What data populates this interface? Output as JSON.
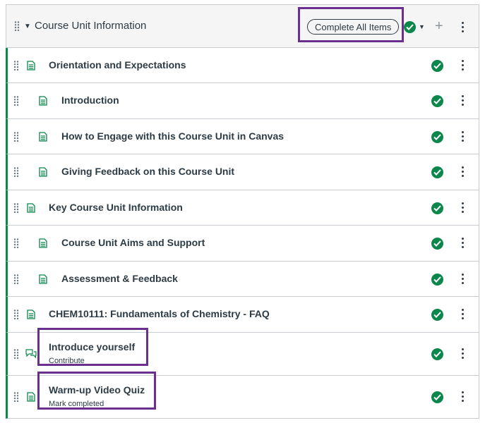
{
  "module": {
    "title": "Course Unit Information",
    "complete_all_label": "Complete All Items"
  },
  "items": [
    {
      "title": "Orientation and Expectations",
      "indent": 0,
      "type": "page",
      "subtitle": ""
    },
    {
      "title": "Introduction",
      "indent": 1,
      "type": "page",
      "subtitle": ""
    },
    {
      "title": "How to Engage with this Course Unit in Canvas",
      "indent": 1,
      "type": "page",
      "subtitle": ""
    },
    {
      "title": "Giving Feedback on this Course Unit",
      "indent": 1,
      "type": "page",
      "subtitle": ""
    },
    {
      "title": "Key Course Unit Information",
      "indent": 0,
      "type": "page",
      "subtitle": ""
    },
    {
      "title": "Course Unit Aims and Support",
      "indent": 1,
      "type": "page",
      "subtitle": ""
    },
    {
      "title": "Assessment & Feedback",
      "indent": 1,
      "type": "page",
      "subtitle": ""
    },
    {
      "title": "CHEM10111: Fundamentals of Chemistry - FAQ",
      "indent": 0,
      "type": "page",
      "subtitle": ""
    },
    {
      "title": "Introduce yourself",
      "indent": 0,
      "type": "discussion",
      "subtitle": "Contribute"
    },
    {
      "title": "Warm-up Video Quiz",
      "indent": 0,
      "type": "page",
      "subtitle": "Mark completed"
    }
  ],
  "colors": {
    "complete": "#0b874b",
    "highlight": "#6b2f8e",
    "text": "#2d3b45"
  },
  "icons": {
    "drag": "drag-handle-icon",
    "page": "page-icon",
    "discussion": "discussion-icon",
    "status": "checkmark-circle-icon",
    "more": "kebab-menu-icon",
    "add": "plus-icon",
    "collapse": "caret-down-icon"
  }
}
